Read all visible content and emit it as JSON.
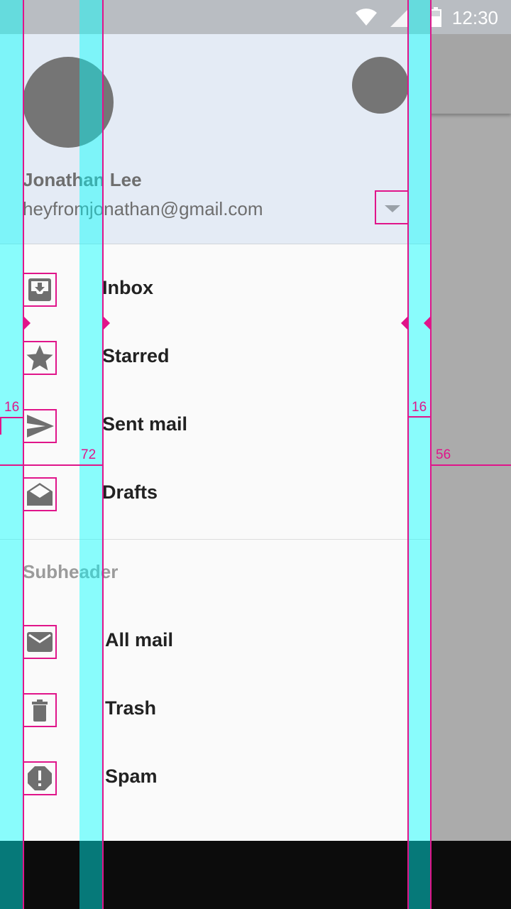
{
  "status_bar": {
    "time": "12:30"
  },
  "account": {
    "name": "Jonathan Lee",
    "email": "heyfromjonathan@gmail.com"
  },
  "nav": {
    "primary": [
      {
        "label": "Inbox",
        "icon": "inbox-icon"
      },
      {
        "label": "Starred",
        "icon": "star-icon"
      },
      {
        "label": "Sent mail",
        "icon": "send-icon"
      },
      {
        "label": "Drafts",
        "icon": "drafts-icon"
      }
    ],
    "subheader": "Subheader",
    "secondary": [
      {
        "label": "All mail",
        "icon": "mail-icon"
      },
      {
        "label": "Trash",
        "icon": "trash-icon"
      },
      {
        "label": "Spam",
        "icon": "spam-icon"
      }
    ]
  },
  "keylines": {
    "left_margin": "16",
    "text_keyline": "72",
    "right_margin": "16",
    "scrim_width": "56"
  },
  "colors": {
    "keyline_magenta": "#e0158a",
    "keyline_cyan": "#00ffff",
    "header_bg": "#e4ebf5",
    "icon_grey": "#757575"
  }
}
